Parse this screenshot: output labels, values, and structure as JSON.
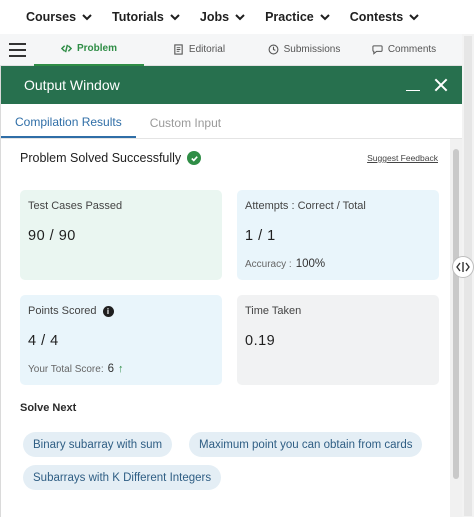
{
  "topnav": {
    "items": [
      {
        "label": "Courses"
      },
      {
        "label": "Tutorials"
      },
      {
        "label": "Jobs"
      },
      {
        "label": "Practice"
      },
      {
        "label": "Contests"
      }
    ]
  },
  "tabs": {
    "problem": "Problem",
    "editorial": "Editorial",
    "submissions": "Submissions",
    "comments": "Comments"
  },
  "output": {
    "title": "Output Window",
    "subtabs": {
      "results": "Compilation Results",
      "custom": "Custom Input"
    },
    "status": "Problem Solved Successfully",
    "feedback": "Suggest Feedback",
    "test_cases": {
      "label": "Test Cases Passed",
      "value": "90 / 90"
    },
    "attempts": {
      "label": "Attempts : Correct / Total",
      "value": "1 / 1",
      "accuracy_label": "Accuracy :",
      "accuracy_value": "100%"
    },
    "points": {
      "label": "Points Scored",
      "value": "4 / 4",
      "total_label": "Your Total Score:",
      "total_value": "6"
    },
    "time": {
      "label": "Time Taken",
      "value": "0.19"
    },
    "solve_next": {
      "heading": "Solve Next",
      "items": [
        "Binary subarray with sum",
        "Maximum point you can obtain from cards",
        "Subarrays with K Different Integers"
      ]
    }
  },
  "colors": {
    "header_green": "#27704e",
    "accent_green": "#2f8d46",
    "link_blue": "#2f6ea7"
  }
}
